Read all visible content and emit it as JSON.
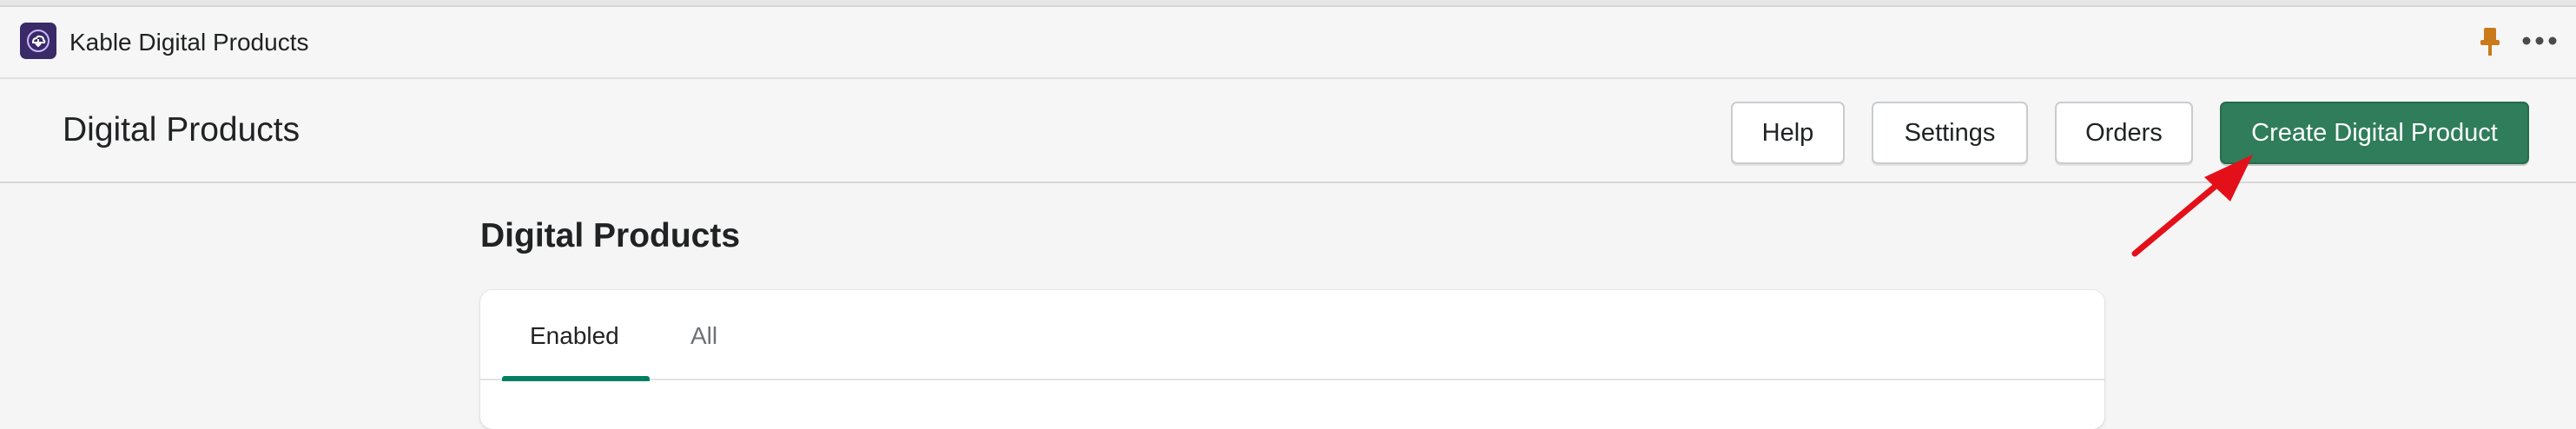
{
  "app": {
    "name": "Kable Digital Products",
    "logo_icon": "cloud-download-icon",
    "pin_icon": "pin-icon",
    "more_icon": "more-horizontal-icon",
    "accent_color": "#2f7d5a"
  },
  "page": {
    "title": "Digital Products",
    "actions": {
      "help": "Help",
      "settings": "Settings",
      "orders": "Orders",
      "create": "Create Digital Product"
    }
  },
  "section": {
    "title": "Digital Products",
    "tabs": [
      {
        "label": "Enabled",
        "selected": true
      },
      {
        "label": "All",
        "selected": false
      }
    ]
  },
  "annotation": {
    "arrow_color": "#e3101a",
    "icon": "red-arrow-annotation"
  }
}
